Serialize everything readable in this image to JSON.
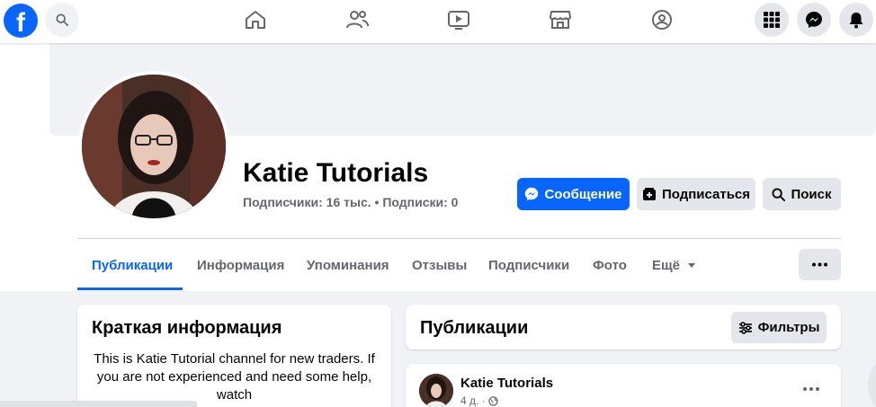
{
  "nav": {
    "logo_letter": "f",
    "icons": [
      "search-icon",
      "home-icon",
      "friends-icon",
      "video-icon",
      "marketplace-icon",
      "groups-icon",
      "menu-grid-icon",
      "messenger-icon",
      "notifications-icon"
    ]
  },
  "profile": {
    "name": "Katie Tutorials",
    "stats": "Подписчики: 16 тыс. • Подписки: 0",
    "buttons": {
      "message": "Сообщение",
      "follow": "Подписаться",
      "search": "Поиск"
    }
  },
  "tabs": [
    {
      "label": "Публикации"
    },
    {
      "label": "Информация"
    },
    {
      "label": "Упоминания"
    },
    {
      "label": "Отзывы"
    },
    {
      "label": "Подписчики"
    },
    {
      "label": "Фото"
    },
    {
      "label": "Ещё"
    }
  ],
  "intro": {
    "title": "Краткая информация",
    "text": "This is Katie Tutorial channel for new traders. If you are not experienced and need some help, watch"
  },
  "posts": {
    "title": "Публикации",
    "filters": "Фильтры",
    "first_post": {
      "author": "Katie Tutorials",
      "time": "4 д. ·"
    }
  },
  "colors": {
    "accent": "#0866ff",
    "secondary_button": "#e4e6eb",
    "muted_text": "#65676b"
  }
}
